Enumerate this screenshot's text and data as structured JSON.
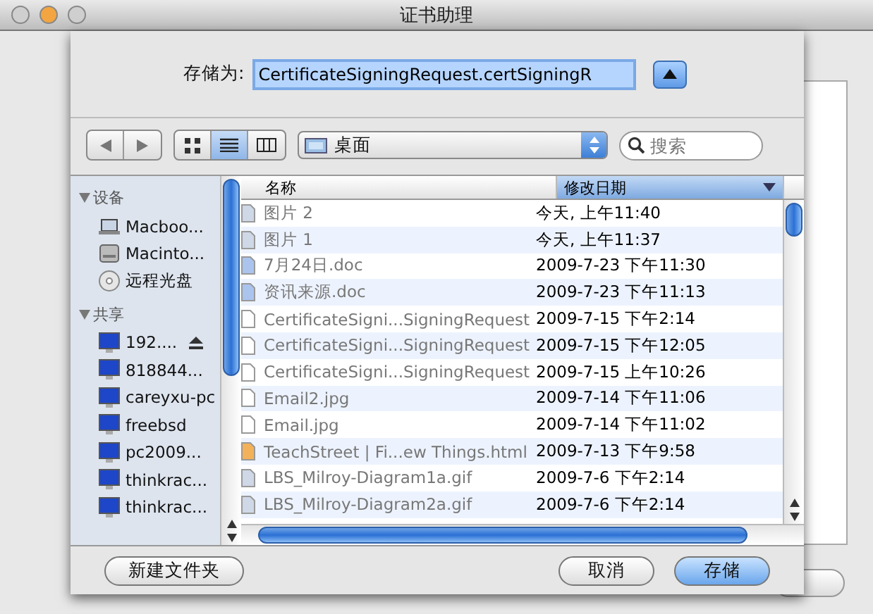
{
  "window": {
    "title": "证书助理"
  },
  "save_as": {
    "label": "存储为:",
    "value": "CertificateSigningRequest.certSigningR",
    "expanded": true
  },
  "toolbar": {
    "view_modes": [
      {
        "kind": "icons",
        "selected": false
      },
      {
        "kind": "list",
        "selected": true
      },
      {
        "kind": "columns",
        "selected": false
      }
    ],
    "location": "桌面",
    "search": {
      "placeholder": "搜索"
    }
  },
  "sidebar": {
    "sections": [
      {
        "title": "设备",
        "expanded": true,
        "items": [
          {
            "label": "Macboo...",
            "kind": "laptop"
          },
          {
            "label": "Macinto...",
            "kind": "disk"
          },
          {
            "label": "远程光盘",
            "kind": "cd"
          }
        ]
      },
      {
        "title": "共享",
        "expanded": true,
        "items": [
          {
            "label": "192....",
            "kind": "monitor",
            "eject": true
          },
          {
            "label": "818844...",
            "kind": "monitor",
            "eject": false
          },
          {
            "label": "careyxu-pc",
            "kind": "monitor",
            "eject": false
          },
          {
            "label": "freebsd",
            "kind": "monitor",
            "eject": false
          },
          {
            "label": "pc2009...",
            "kind": "monitor",
            "eject": false
          },
          {
            "label": "thinkrac...",
            "kind": "monitor",
            "eject": false
          },
          {
            "label": "thinkrac...",
            "kind": "monitor",
            "eject": false
          }
        ]
      }
    ]
  },
  "table": {
    "columns": [
      {
        "label": "名称",
        "sorted": false
      },
      {
        "label": "修改日期",
        "sorted": true
      }
    ],
    "rows": [
      {
        "name": "图片 2",
        "date": "今天, 上午11:40",
        "kind": "image"
      },
      {
        "name": "图片 1",
        "date": "今天, 上午11:37",
        "kind": "image"
      },
      {
        "name": "7月24日.doc",
        "date": "2009-7-23 下午11:30",
        "kind": "doc"
      },
      {
        "name": "资讯来源.doc",
        "date": "2009-7-23 下午11:13",
        "kind": "doc"
      },
      {
        "name": "CertificateSigni...SigningRequest",
        "date": "2009-7-15 下午2:14",
        "kind": "file"
      },
      {
        "name": "CertificateSigni...SigningRequest",
        "date": "2009-7-15 下午12:05",
        "kind": "file"
      },
      {
        "name": "CertificateSigni...SigningRequest",
        "date": "2009-7-15 上午10:26",
        "kind": "file"
      },
      {
        "name": "Email2.jpg",
        "date": "2009-7-14 下午11:06",
        "kind": "file"
      },
      {
        "name": "Email.jpg",
        "date": "2009-7-14 下午11:02",
        "kind": "file"
      },
      {
        "name": "TeachStreet | Fi...ew Things.html",
        "date": "2009-7-13 下午9:58",
        "kind": "html"
      },
      {
        "name": "LBS_Milroy-Diagram1a.gif",
        "date": "2009-7-6 下午2:14",
        "kind": "image"
      },
      {
        "name": "LBS_Milroy-Diagram2a.gif",
        "date": "2009-7-6 下午2:14",
        "kind": "image"
      }
    ]
  },
  "buttons": [
    {
      "label": "新建文件夹",
      "kind": "normal"
    },
    {
      "label": "取消",
      "kind": "normal"
    },
    {
      "label": "存储",
      "kind": "default"
    }
  ]
}
